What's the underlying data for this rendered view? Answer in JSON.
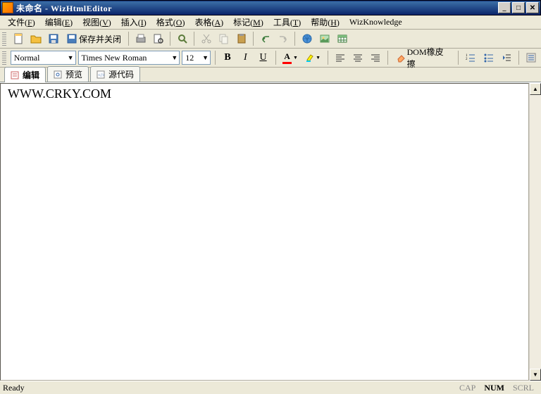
{
  "title": "未命名 - WizHtmlEditor",
  "menu": {
    "file": {
      "label": "文件",
      "h": "F"
    },
    "edit": {
      "label": "编辑",
      "h": "E"
    },
    "view": {
      "label": "视图",
      "h": "V"
    },
    "insert": {
      "label": "插入",
      "h": "I"
    },
    "format": {
      "label": "格式",
      "h": "O"
    },
    "table": {
      "label": "表格",
      "h": "A"
    },
    "mark": {
      "label": "标记",
      "h": "M"
    },
    "tools": {
      "label": "工具",
      "h": "T"
    },
    "help": {
      "label": "帮助",
      "h": "H"
    },
    "wiz": {
      "label": "WizKnowledge"
    }
  },
  "toolbar": {
    "saveclose": "保存并关闭"
  },
  "format": {
    "style": "Normal",
    "font": "Times New Roman",
    "size": "12",
    "bold": "B",
    "italic": "I",
    "underline": "U",
    "dom": "DOM橡皮擦"
  },
  "tabs": {
    "edit": "编辑",
    "preview": "预览",
    "source": "源代码"
  },
  "editor": {
    "content": "WWW.CRKY.COM"
  },
  "status": {
    "ready": "Ready",
    "cap": "CAP",
    "num": "NUM",
    "scrl": "SCRL"
  }
}
